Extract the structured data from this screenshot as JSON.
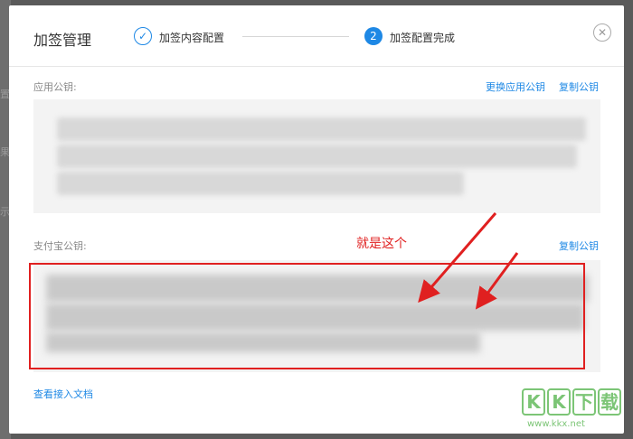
{
  "dialog": {
    "title": "加签管理",
    "step1_label": "加签内容配置",
    "step2_number": "2",
    "step2_label": "加签配置完成",
    "check_glyph": "✓",
    "close_glyph": "✕"
  },
  "app_key": {
    "label": "应用公钥:",
    "replace_link": "更换应用公钥",
    "copy_link": "复制公钥"
  },
  "alipay_key": {
    "label": "支付宝公钥:",
    "copy_link": "复制公钥"
  },
  "annotation": {
    "text": "就是这个",
    "color": "#e02020"
  },
  "doc_link": "查看接入文档",
  "watermark": {
    "letters": [
      "K",
      "K",
      "下",
      "载"
    ],
    "url": "www.kkx.net"
  },
  "colors": {
    "accent": "#1e88e5",
    "annotation_red": "#e02020",
    "watermark_green": "#7cc576"
  }
}
